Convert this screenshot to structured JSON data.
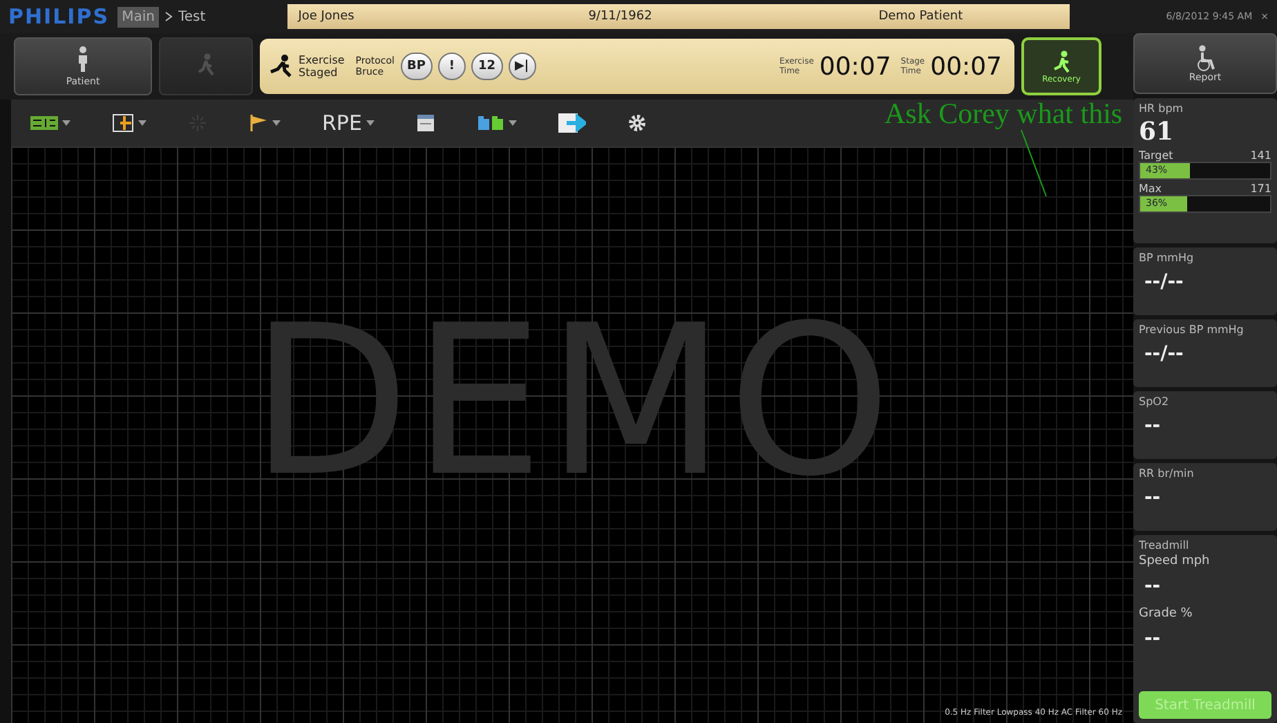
{
  "header": {
    "logo": "PHILIPS",
    "breadcrumb": [
      "Main",
      "Test"
    ],
    "patient_name": "Joe Jones",
    "birth_date": "9/11/1962",
    "patient_type": "Demo Patient",
    "datetime": "6/8/2012 9:45 AM",
    "close": "×"
  },
  "phase_buttons": [
    {
      "label": "Patient",
      "kind": "patient",
      "disabled": false
    },
    {
      "kind": "walk",
      "disabled": true
    }
  ],
  "exercise_panel": {
    "status": [
      "Exercise",
      "Staged"
    ],
    "protocol": [
      "Protocol",
      "Bruce"
    ],
    "buttons": [
      "BP",
      "!",
      "12",
      "▶|"
    ],
    "exercise_time_label": [
      "Exercise",
      "Time"
    ],
    "exercise_time": "00:07",
    "stage_time_label": [
      "Stage",
      "Time"
    ],
    "stage_time": "00:07"
  },
  "recovery_button": {
    "label": "Recovery",
    "selected": true
  },
  "report_button": {
    "label": "Report"
  },
  "toolbar": [
    {
      "kind": "layout",
      "caret": true,
      "disabled": false
    },
    {
      "kind": "lead",
      "caret": true,
      "disabled": false
    },
    {
      "kind": "sparkle",
      "caret": false,
      "disabled": true
    },
    {
      "kind": "flag",
      "caret": true,
      "disabled": false
    },
    {
      "kind": "text",
      "label": "RPE",
      "caret": true,
      "disabled": false
    },
    {
      "kind": "window",
      "caret": false,
      "disabled": false
    },
    {
      "kind": "folders",
      "caret": true,
      "disabled": false
    },
    {
      "kind": "export",
      "caret": false,
      "disabled": false
    },
    {
      "kind": "gear",
      "caret": false,
      "disabled": false
    }
  ],
  "ecg_area": {
    "watermark": "DEMO",
    "footer": "0.5 Hz Filter  Lowpass 40 Hz  AC Filter 60 Hz"
  },
  "annotation": {
    "text": "Ask Corey what this"
  },
  "vitals": [
    {
      "kind": "hr",
      "label": "HR bpm",
      "value": "61",
      "gauges": [
        {
          "label": "Target",
          "reading": "141",
          "fill_text": "43%",
          "level": 0.38
        },
        {
          "label": "Max",
          "reading": "171",
          "fill_text": "36%",
          "level": 0.36
        }
      ]
    },
    {
      "kind": "simple",
      "label": "BP mmHg",
      "value": "--/--"
    },
    {
      "kind": "simple",
      "label": "Previous BP mmHg",
      "value": "--/--"
    },
    {
      "kind": "simple",
      "label": "SpO2",
      "value": "--"
    },
    {
      "kind": "simple",
      "label": "RR br/min",
      "value": "--"
    },
    {
      "kind": "treadmill",
      "label": "Treadmill",
      "fields": [
        {
          "label": "Speed mph",
          "value": "--"
        },
        {
          "label": "Grade %",
          "value": "--"
        }
      ],
      "button": "Start Treadmill"
    }
  ]
}
